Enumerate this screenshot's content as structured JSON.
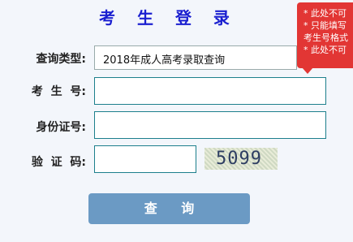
{
  "title": "考 生 登 录",
  "form": {
    "type_label": "查询类型:",
    "type_value": "2018年成人高考录取查询",
    "exam_no_label": "考  生  号:",
    "id_label": "身份证号:",
    "captcha_label": "验  证  码:",
    "captcha_text": "5099",
    "exam_no_value": "",
    "id_value": "",
    "captcha_value": ""
  },
  "submit_label": "查 询",
  "tooltip": {
    "lines": [
      "* 此处不可",
      "* 只能填写",
      "考生号格式",
      "* 此处不可"
    ]
  }
}
